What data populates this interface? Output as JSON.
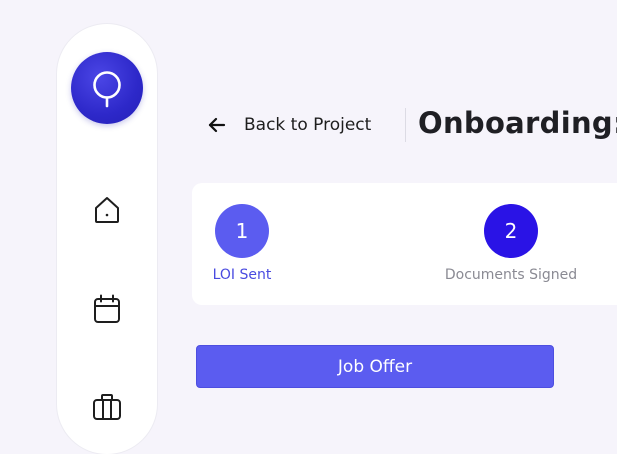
{
  "sidebar": {
    "logo_icon": "location-pin-icon",
    "nav_items": [
      {
        "icon": "home-icon"
      },
      {
        "icon": "calendar-icon"
      },
      {
        "icon": "briefcase-icon"
      }
    ]
  },
  "header": {
    "back_label": "Back to Project",
    "back_icon": "arrow-left-icon",
    "title": "Onboarding:"
  },
  "steps": [
    {
      "number": "1",
      "label": "LOI Sent",
      "circle_color": "#5b5cf0",
      "label_color": "#4a4be0"
    },
    {
      "number": "2",
      "label": "Documents Signed",
      "circle_color": "#2a13e6",
      "label_color": "#8a8a93"
    }
  ],
  "actions": {
    "job_offer_label": "Job Offer"
  },
  "colors": {
    "accent": "#5b5cf0",
    "accent_dark": "#2a13e6",
    "background": "#f6f4fb"
  }
}
